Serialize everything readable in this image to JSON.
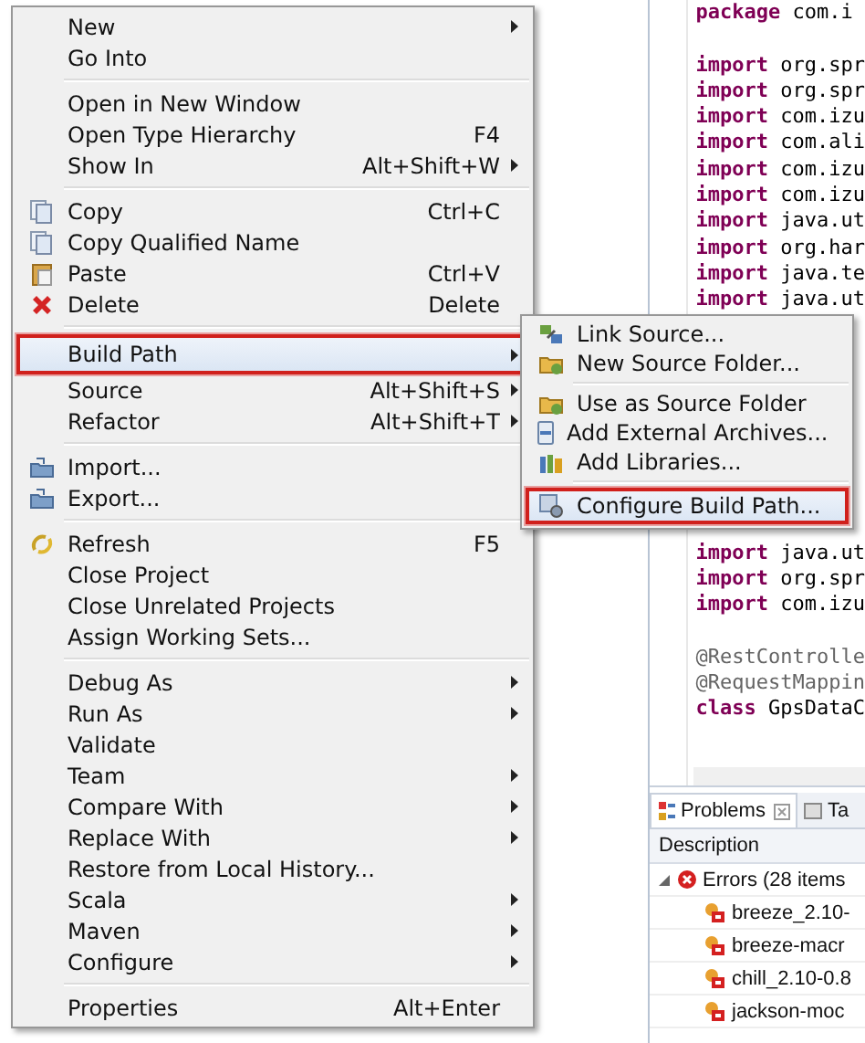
{
  "editor": {
    "lines": [
      {
        "kind": "statement",
        "keyword": "package",
        "text": "com.i"
      },
      {
        "kind": "blank"
      },
      {
        "kind": "statement",
        "keyword": "import",
        "text": "org.spr"
      },
      {
        "kind": "statement",
        "keyword": "import",
        "text": "org.spr"
      },
      {
        "kind": "statement",
        "keyword": "import",
        "text": "com.izu"
      },
      {
        "kind": "statement",
        "keyword": "import",
        "text": "com.ali"
      },
      {
        "kind": "statement",
        "keyword": "import",
        "text": "com.izu"
      },
      {
        "kind": "statement",
        "keyword": "import",
        "text": "com.izu"
      },
      {
        "kind": "statement",
        "keyword": "import",
        "text": "java.ut"
      },
      {
        "kind": "statement",
        "keyword": "import",
        "text": "org.har"
      },
      {
        "kind": "statement",
        "keyword": "import",
        "text": "java.te"
      },
      {
        "kind": "statement",
        "keyword": "import",
        "text": "java.ut"
      },
      {
        "kind": "hidden"
      },
      {
        "kind": "hidden"
      },
      {
        "kind": "hidden"
      },
      {
        "kind": "hidden"
      },
      {
        "kind": "hidden"
      },
      {
        "kind": "hidden"
      },
      {
        "kind": "hidden"
      },
      {
        "kind": "hidden"
      },
      {
        "kind": "statement",
        "keyword": "import",
        "text": "java.ut"
      },
      {
        "kind": "statement",
        "keyword": "import",
        "text": "org.spr"
      },
      {
        "kind": "statement",
        "keyword": "import",
        "text": "com.izu"
      },
      {
        "kind": "blank"
      },
      {
        "kind": "annotation",
        "text": "@RestControlle"
      },
      {
        "kind": "annotation",
        "text": "@RequestMappin"
      },
      {
        "kind": "statement",
        "keyword": "class",
        "text": "GpsDataC"
      }
    ]
  },
  "problems": {
    "tabs": [
      {
        "label": "Problems",
        "selected": true
      },
      {
        "label": "Ta",
        "selected": false
      }
    ],
    "column": "Description",
    "tree": [
      {
        "label": "Errors (28 items",
        "expanded": true,
        "children": [
          {
            "label": "breeze_2.10-"
          },
          {
            "label": "breeze-macr"
          },
          {
            "label": "chill_2.10-0.8"
          },
          {
            "label": "jackson-moc"
          }
        ]
      }
    ]
  },
  "menu": {
    "sections": [
      [
        {
          "label": "New",
          "submenu": true,
          "selected": false
        },
        {
          "label": "Go Into",
          "submenu": false,
          "selected": false
        }
      ],
      [
        {
          "label": "Open in New Window",
          "submenu": false,
          "selected": false
        },
        {
          "label": "Open Type Hierarchy",
          "shortcut": "F4",
          "submenu": false,
          "selected": false
        },
        {
          "label": "Show In",
          "shortcut": "Alt+Shift+W",
          "submenu": true,
          "selected": false
        }
      ],
      [
        {
          "label": "Copy",
          "kind": "copy",
          "shortcut": "Ctrl+C",
          "submenu": false,
          "selected": false
        },
        {
          "label": "Copy Qualified Name",
          "kind": "copy",
          "submenu": false,
          "selected": false
        },
        {
          "label": "Paste",
          "kind": "paste",
          "shortcut": "Ctrl+V",
          "submenu": false,
          "selected": false
        },
        {
          "label": "Delete",
          "kind": "delete",
          "shortcut": "Delete",
          "submenu": false,
          "selected": false
        }
      ],
      [
        {
          "label": "Build Path",
          "submenu": true,
          "selected": true
        },
        {
          "label": "Source",
          "shortcut": "Alt+Shift+S",
          "submenu": true,
          "selected": false
        },
        {
          "label": "Refactor",
          "shortcut": "Alt+Shift+T",
          "submenu": true,
          "selected": false
        }
      ],
      [
        {
          "label": "Import...",
          "kind": "import",
          "submenu": false,
          "selected": false
        },
        {
          "label": "Export...",
          "kind": "import",
          "submenu": false,
          "selected": false
        }
      ],
      [
        {
          "label": "Refresh",
          "kind": "refresh",
          "shortcut": "F5",
          "submenu": false,
          "selected": false
        },
        {
          "label": "Close Project",
          "submenu": false,
          "selected": false
        },
        {
          "label": "Close Unrelated Projects",
          "submenu": false,
          "selected": false
        },
        {
          "label": "Assign Working Sets...",
          "submenu": false,
          "selected": false
        }
      ],
      [
        {
          "label": "Debug As",
          "submenu": true,
          "selected": false
        },
        {
          "label": "Run As",
          "submenu": true,
          "selected": false
        },
        {
          "label": "Validate",
          "submenu": false,
          "selected": false
        },
        {
          "label": "Team",
          "submenu": true,
          "selected": false
        },
        {
          "label": "Compare With",
          "submenu": true,
          "selected": false
        },
        {
          "label": "Replace With",
          "submenu": true,
          "selected": false
        },
        {
          "label": "Restore from Local History...",
          "submenu": false,
          "selected": false
        },
        {
          "label": "Scala",
          "submenu": true,
          "selected": false
        },
        {
          "label": "Maven",
          "submenu": true,
          "selected": false
        },
        {
          "label": "Configure",
          "submenu": true,
          "selected": false
        }
      ],
      [
        {
          "label": "Properties",
          "shortcut": "Alt+Enter",
          "submenu": false,
          "selected": false
        }
      ]
    ]
  },
  "submenu": {
    "sections": [
      [
        {
          "label": "Link Source...",
          "kind": "link",
          "submenu": false,
          "selected": false
        },
        {
          "label": "New Source Folder...",
          "kind": "folder",
          "submenu": false,
          "selected": false
        }
      ],
      [
        {
          "label": "Use as Source Folder",
          "kind": "folder",
          "submenu": false,
          "selected": false
        },
        {
          "label": "Add External Archives...",
          "kind": "jar",
          "submenu": false,
          "selected": false
        },
        {
          "label": "Add Libraries...",
          "kind": "library",
          "submenu": false,
          "selected": false
        }
      ],
      [
        {
          "label": "Configure Build Path...",
          "kind": "config",
          "submenu": false,
          "selected": true
        }
      ]
    ]
  }
}
